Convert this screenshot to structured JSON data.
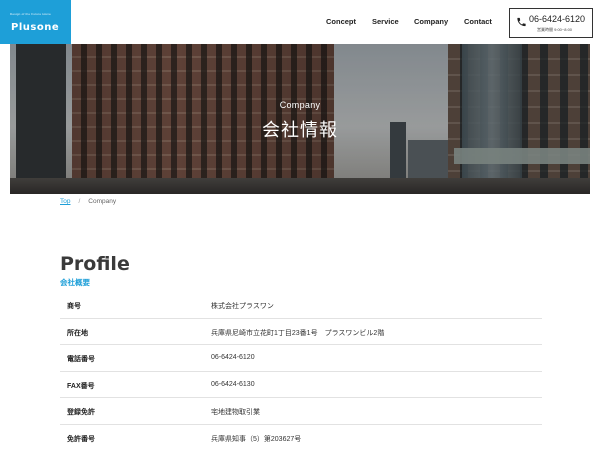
{
  "header": {
    "logo_tagline": "Design of the Future Home",
    "logo_name": "Plusone",
    "nav": [
      "Concept",
      "Service",
      "Company",
      "Contact"
    ],
    "tel": {
      "number": "06-6424-6120",
      "hours": "営業時間 9:00~8:00"
    }
  },
  "hero": {
    "subtitle": "Company",
    "title": "会社情報"
  },
  "breadcrumb": {
    "top": "Top",
    "separator": "/",
    "current": "Company"
  },
  "profile": {
    "title": "Profile",
    "subtitle": "会社概要",
    "rows": [
      {
        "label": "商号",
        "value": "株式会社プラスワン"
      },
      {
        "label": "所在地",
        "value": "兵庫県尼崎市立花町1丁目23番1号　プラスワンビル2階"
      },
      {
        "label": "電話番号",
        "value": "06-6424-6120"
      },
      {
        "label": "FAX番号",
        "value": "06-6424-6130"
      },
      {
        "label": "登録免許",
        "value": "宅地建物取引業"
      },
      {
        "label": "免許番号",
        "value": "兵庫県知事（5）第203627号"
      }
    ]
  },
  "colors": {
    "accent": "#1e9fd8"
  }
}
